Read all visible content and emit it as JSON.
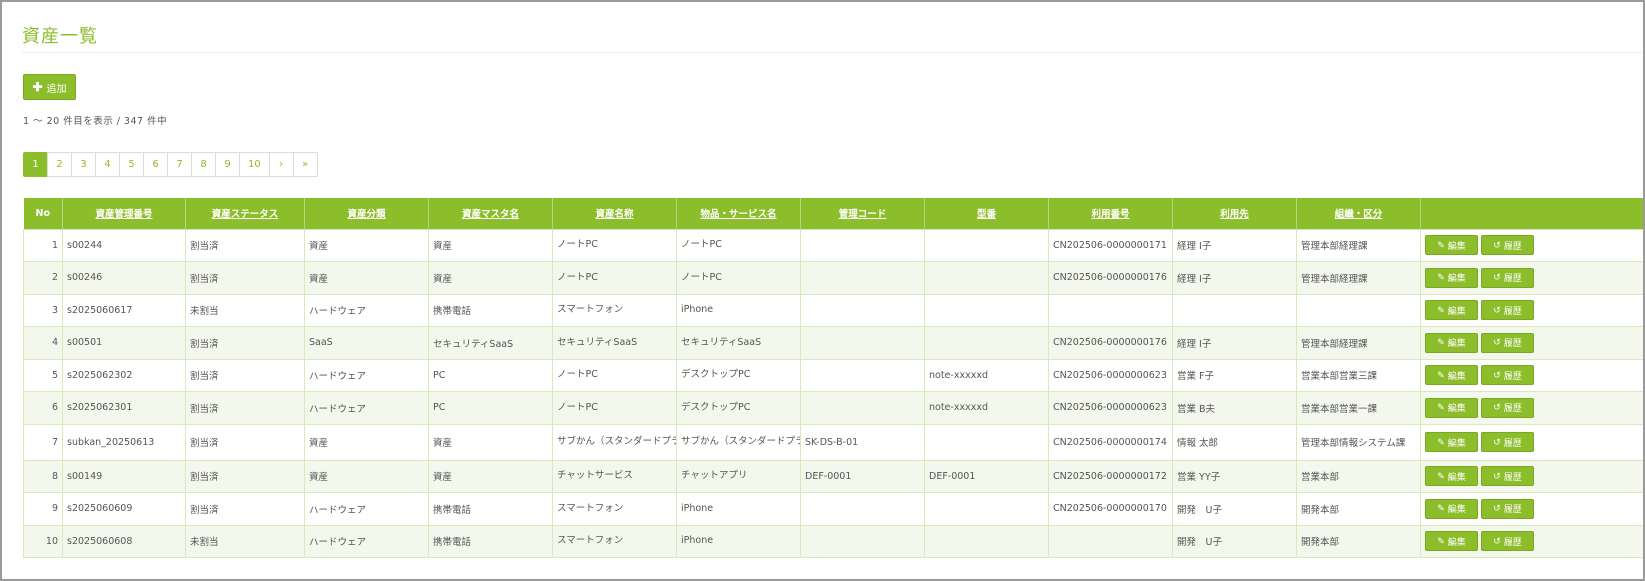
{
  "page": {
    "title": "資産一覧"
  },
  "toolbar": {
    "add_icon": "plus-icon",
    "add_label": "追加"
  },
  "summary": "1 〜 20 件目を表示 / 347 件中",
  "pagination": {
    "pages": [
      "1",
      "2",
      "3",
      "4",
      "5",
      "6",
      "7",
      "8",
      "9",
      "10"
    ],
    "current": "1",
    "next": "›",
    "last": "»"
  },
  "table": {
    "columns": [
      "No",
      "資産管理番号",
      "資産ステータス",
      "資産分類",
      "資産マスタ名",
      "資産名称",
      "物品・サービス名",
      "管理コード",
      "型番",
      "利用番号",
      "利用先",
      "組織・区分",
      ""
    ],
    "rows": [
      {
        "no": "1",
        "asset_id": "s00244",
        "status": "割当済",
        "category": "資産",
        "master": "資産",
        "name": "ノートPC",
        "product": "ノートPC",
        "code": "",
        "model": "",
        "usage_no": "CN202506-0000000171",
        "user": "経理 I子",
        "org": "管理本部経理課"
      },
      {
        "no": "2",
        "asset_id": "s00246",
        "status": "割当済",
        "category": "資産",
        "master": "資産",
        "name": "ノートPC",
        "product": "ノートPC",
        "code": "",
        "model": "",
        "usage_no": "CN202506-0000000176",
        "user": "経理 I子",
        "org": "管理本部経理課"
      },
      {
        "no": "3",
        "asset_id": "s2025060617",
        "status": "未割当",
        "category": "ハードウェア",
        "master": "携帯電話",
        "name": "スマートフォン",
        "product": "iPhone",
        "code": "",
        "model": "",
        "usage_no": "",
        "user": "",
        "org": ""
      },
      {
        "no": "4",
        "asset_id": "s00501",
        "status": "割当済",
        "category": "SaaS",
        "master": "セキュリティSaaS",
        "name": "セキュリティSaaS",
        "product": "セキュリティSaaS",
        "code": "",
        "model": "",
        "usage_no": "CN202506-0000000176",
        "user": "経理 I子",
        "org": "管理本部経理課"
      },
      {
        "no": "5",
        "asset_id": "s2025062302",
        "status": "割当済",
        "category": "ハードウェア",
        "master": "PC",
        "name": "ノートPC",
        "product": "デスクトップPC",
        "code": "",
        "model": "note-xxxxxd",
        "usage_no": "CN202506-0000000623",
        "user": "営業 F子",
        "org": "営業本部営業三課"
      },
      {
        "no": "6",
        "asset_id": "s2025062301",
        "status": "割当済",
        "category": "ハードウェア",
        "master": "PC",
        "name": "ノートPC",
        "product": "デスクトップPC",
        "code": "",
        "model": "note-xxxxxd",
        "usage_no": "CN202506-0000000623",
        "user": "営業 B夫",
        "org": "営業本部営業一課"
      },
      {
        "no": "7",
        "asset_id": "subkan_20250613",
        "status": "割当済",
        "category": "資産",
        "master": "資産",
        "name": "サブかん（スタンダードプラン）",
        "product": "サブかん（スタンダードプラン）",
        "code": "SK-DS-B-01",
        "model": "",
        "usage_no": "CN202506-0000000174",
        "user": "情報 太郎",
        "org": "管理本部情報システム課"
      },
      {
        "no": "8",
        "asset_id": "s00149",
        "status": "割当済",
        "category": "資産",
        "master": "資産",
        "name": "チャットサービス",
        "product": "チャットアプリ",
        "code": "DEF-0001",
        "model": "DEF-0001",
        "usage_no": "CN202506-0000000172",
        "user": "営業 YY子",
        "org": "営業本部"
      },
      {
        "no": "9",
        "asset_id": "s2025060609",
        "status": "割当済",
        "category": "ハードウェア",
        "master": "携帯電話",
        "name": "スマートフォン",
        "product": "iPhone",
        "code": "",
        "model": "",
        "usage_no": "CN202506-0000000170",
        "user": "開発　U子",
        "org": "開発本部"
      },
      {
        "no": "10",
        "asset_id": "s2025060608",
        "status": "未割当",
        "category": "ハードウェア",
        "master": "携帯電話",
        "name": "スマートフォン",
        "product": "iPhone",
        "code": "",
        "model": "",
        "usage_no": "",
        "user": "開発　U子",
        "org": "開発本部"
      }
    ],
    "edit_label": "編集",
    "edit_icon": "edit-icon",
    "history_label": "履歴",
    "history_icon": "history-icon"
  },
  "colors": {
    "accent": "#8cbd2b",
    "row_alt": "#f4f8ec",
    "border": "#d9e9bf"
  }
}
